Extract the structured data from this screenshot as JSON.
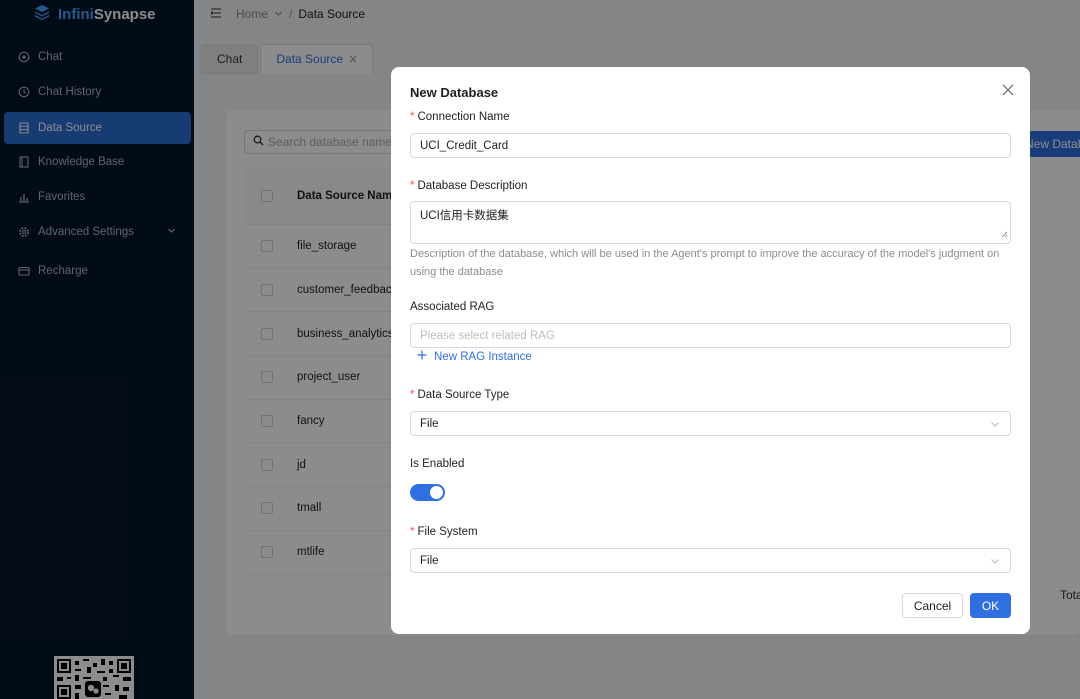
{
  "app": {
    "name_part1": "Infini",
    "name_part2": "Synapse"
  },
  "sidebar": {
    "items": [
      {
        "label": "Chat",
        "icon": "chat-icon"
      },
      {
        "label": "Chat History",
        "icon": "history-icon"
      },
      {
        "label": "Data Source",
        "icon": "database-icon",
        "active": true
      },
      {
        "label": "Knowledge Base",
        "icon": "book-icon"
      },
      {
        "label": "Favorites",
        "icon": "bar-chart-icon"
      },
      {
        "label": "Advanced Settings",
        "icon": "gear-icon"
      },
      {
        "label": "Recharge",
        "icon": "wallet-icon"
      }
    ]
  },
  "breadcrumb": {
    "home": "Home",
    "separator": "/",
    "current": "Data Source"
  },
  "tabs": [
    {
      "label": "Chat"
    },
    {
      "label": "Data Source",
      "active": true
    }
  ],
  "search": {
    "placeholder": "Search database name"
  },
  "toolbar": {
    "new_database_label": "New Database"
  },
  "table": {
    "header": "Data Source Name",
    "rows": [
      "file_storage",
      "customer_feedback",
      "business_analytics",
      "project_user",
      "fancy",
      "jd",
      "tmall",
      "mtlife"
    ]
  },
  "pagination": {
    "total_label": "Total"
  },
  "modal": {
    "title": "New Database",
    "connection_name_label": "Connection Name",
    "connection_name_value": "UCI_Credit_Card",
    "description_label": "Database Description",
    "description_value": "UCI信用卡数据集",
    "description_help": "Description of the database, which will be used in the Agent's prompt to improve the accuracy of the model's judgment on using the database",
    "rag_label": "Associated RAG",
    "rag_placeholder": "Please select related RAG",
    "new_rag_label": "New RAG Instance",
    "type_label": "Data Source Type",
    "type_value": "File",
    "enabled_label": "Is Enabled",
    "enabled": true,
    "fs_label": "File System",
    "fs_value": "File",
    "cancel_label": "Cancel",
    "ok_label": "OK"
  },
  "colors": {
    "primary": "#2f6fe0",
    "sidebar_bg": "#051629",
    "required": "#ff4d4f"
  }
}
